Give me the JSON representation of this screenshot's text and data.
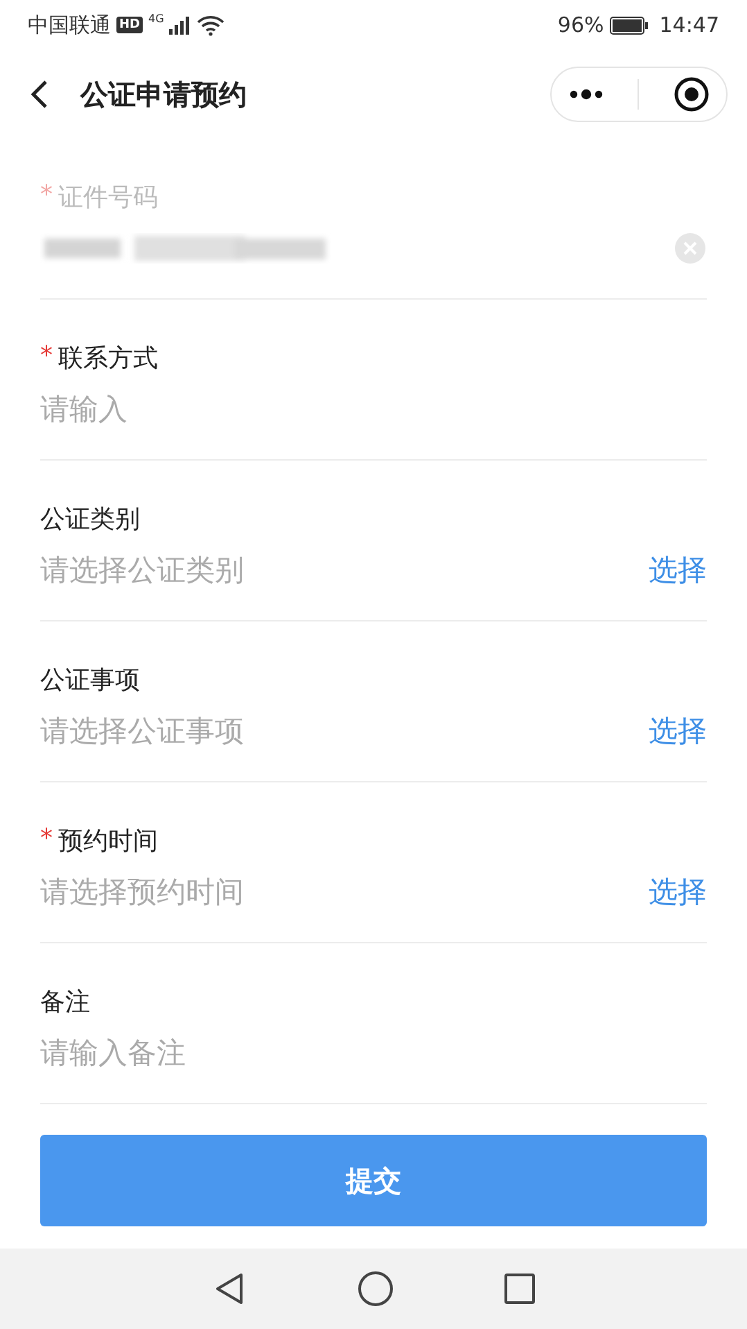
{
  "status_bar": {
    "carrier": "中国联通",
    "hd": "HD",
    "network": "4G",
    "battery": "96%",
    "time": "14:47"
  },
  "nav": {
    "title": "公证申请预约"
  },
  "fields": [
    {
      "kind": "redacted",
      "label": "证件号码",
      "required": true,
      "disabled": true
    },
    {
      "kind": "input",
      "label": "联系方式",
      "required": true,
      "disabled": false,
      "placeholder": "请输入"
    },
    {
      "kind": "select",
      "label": "公证类别",
      "required": false,
      "disabled": false,
      "placeholder": "请选择公证类别",
      "action": "选择"
    },
    {
      "kind": "select",
      "label": "公证事项",
      "required": false,
      "disabled": false,
      "placeholder": "请选择公证事项",
      "action": "选择"
    },
    {
      "kind": "select",
      "label": "预约时间",
      "required": true,
      "disabled": false,
      "placeholder": "请选择预约时间",
      "action": "选择"
    },
    {
      "kind": "input",
      "label": "备注",
      "required": false,
      "disabled": false,
      "placeholder": "请输入备注"
    }
  ],
  "required_mark": "*",
  "submit": "提交"
}
